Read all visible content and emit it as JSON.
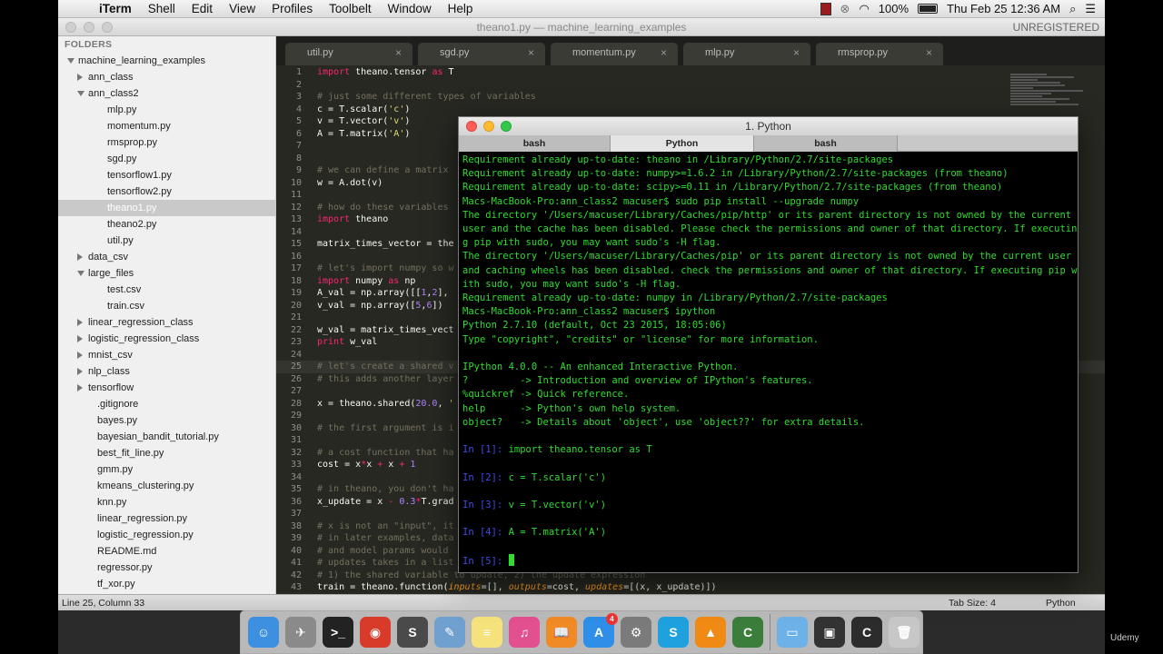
{
  "menubar": {
    "app": "iTerm",
    "items": [
      "Shell",
      "Edit",
      "View",
      "Profiles",
      "Toolbelt",
      "Window",
      "Help"
    ],
    "battery": "100%",
    "clock": "Thu Feb 25  12:36 AM"
  },
  "sublime": {
    "title": "theano1.py — machine_learning_examples",
    "registration": "UNREGISTERED"
  },
  "sidebar": {
    "header": "FOLDERS",
    "tree": [
      {
        "label": "machine_learning_examples",
        "depth": 0,
        "type": "folder-open"
      },
      {
        "label": "ann_class",
        "depth": 1,
        "type": "folder-closed"
      },
      {
        "label": "ann_class2",
        "depth": 1,
        "type": "folder-open"
      },
      {
        "label": "mlp.py",
        "depth": 2,
        "type": "file"
      },
      {
        "label": "momentum.py",
        "depth": 2,
        "type": "file"
      },
      {
        "label": "rmsprop.py",
        "depth": 2,
        "type": "file"
      },
      {
        "label": "sgd.py",
        "depth": 2,
        "type": "file"
      },
      {
        "label": "tensorflow1.py",
        "depth": 2,
        "type": "file"
      },
      {
        "label": "tensorflow2.py",
        "depth": 2,
        "type": "file"
      },
      {
        "label": "theano1.py",
        "depth": 2,
        "type": "file",
        "selected": true
      },
      {
        "label": "theano2.py",
        "depth": 2,
        "type": "file"
      },
      {
        "label": "util.py",
        "depth": 2,
        "type": "file"
      },
      {
        "label": "data_csv",
        "depth": 1,
        "type": "folder-closed"
      },
      {
        "label": "large_files",
        "depth": 1,
        "type": "folder-open"
      },
      {
        "label": "test.csv",
        "depth": 2,
        "type": "file"
      },
      {
        "label": "train.csv",
        "depth": 2,
        "type": "file"
      },
      {
        "label": "linear_regression_class",
        "depth": 1,
        "type": "folder-closed"
      },
      {
        "label": "logistic_regression_class",
        "depth": 1,
        "type": "folder-closed"
      },
      {
        "label": "mnist_csv",
        "depth": 1,
        "type": "folder-closed"
      },
      {
        "label": "nlp_class",
        "depth": 1,
        "type": "folder-closed"
      },
      {
        "label": "tensorflow",
        "depth": 1,
        "type": "folder-closed"
      },
      {
        "label": ".gitignore",
        "depth": 1,
        "type": "file"
      },
      {
        "label": "bayes.py",
        "depth": 1,
        "type": "file"
      },
      {
        "label": "bayesian_bandit_tutorial.py",
        "depth": 1,
        "type": "file"
      },
      {
        "label": "best_fit_line.py",
        "depth": 1,
        "type": "file"
      },
      {
        "label": "gmm.py",
        "depth": 1,
        "type": "file"
      },
      {
        "label": "kmeans_clustering.py",
        "depth": 1,
        "type": "file"
      },
      {
        "label": "knn.py",
        "depth": 1,
        "type": "file"
      },
      {
        "label": "linear_regression.py",
        "depth": 1,
        "type": "file"
      },
      {
        "label": "logistic_regression.py",
        "depth": 1,
        "type": "file"
      },
      {
        "label": "README.md",
        "depth": 1,
        "type": "file"
      },
      {
        "label": "regressor.py",
        "depth": 1,
        "type": "file"
      },
      {
        "label": "tf_xor.py",
        "depth": 1,
        "type": "file"
      }
    ]
  },
  "editor": {
    "tabs": [
      {
        "label": "util.py",
        "close": "×"
      },
      {
        "label": "sgd.py",
        "close": "×"
      },
      {
        "label": "momentum.py",
        "close": "×"
      },
      {
        "label": "mlp.py",
        "close": "×"
      },
      {
        "label": "rmsprop.py",
        "close": "×"
      }
    ],
    "highlighted_line": 25,
    "lines": [
      {
        "n": "1",
        "html": "<span class='k'>import</span> theano.tensor <span class='k'>as</span> T"
      },
      {
        "n": "2",
        "html": ""
      },
      {
        "n": "3",
        "html": "<span class='c'># just some different types of variables</span>"
      },
      {
        "n": "4",
        "html": "c = T.scalar(<span class='s'>'c'</span>)"
      },
      {
        "n": "5",
        "html": "v = T.vector(<span class='s'>'v'</span>)"
      },
      {
        "n": "6",
        "html": "A = T.matrix(<span class='s'>'A'</span>)"
      },
      {
        "n": "7",
        "html": ""
      },
      {
        "n": "8",
        "html": ""
      },
      {
        "n": "9",
        "html": "<span class='c'># we can define a matrix</span>"
      },
      {
        "n": "10",
        "html": "w = A.dot(v)"
      },
      {
        "n": "11",
        "html": ""
      },
      {
        "n": "12",
        "html": "<span class='c'># how do these variables</span>"
      },
      {
        "n": "13",
        "html": "<span class='k'>import</span> theano"
      },
      {
        "n": "14",
        "html": ""
      },
      {
        "n": "15",
        "html": "matrix_times_vector = the"
      },
      {
        "n": "16",
        "html": ""
      },
      {
        "n": "17",
        "html": "<span class='c'># let's import numpy so w</span>"
      },
      {
        "n": "18",
        "html": "<span class='k'>import</span> numpy <span class='k'>as</span> np"
      },
      {
        "n": "19",
        "html": "A_val = np.array([[<span class='n'>1</span>,<span class='n'>2</span>],"
      },
      {
        "n": "20",
        "html": "v_val = np.array([<span class='n'>5</span>,<span class='n'>6</span>])"
      },
      {
        "n": "21",
        "html": ""
      },
      {
        "n": "22",
        "html": "w_val = matrix_times_vect"
      },
      {
        "n": "23",
        "html": "<span class='k'>print</span> w_val"
      },
      {
        "n": "24",
        "html": ""
      },
      {
        "n": "25",
        "html": "<span class='c'># let's create a shared v</span>"
      },
      {
        "n": "26",
        "html": "<span class='c'># this adds another layer</span>"
      },
      {
        "n": "27",
        "html": ""
      },
      {
        "n": "28",
        "html": "x = theano.shared(<span class='n'>20.0</span>, <span class='s'>'</span>"
      },
      {
        "n": "29",
        "html": ""
      },
      {
        "n": "30",
        "html": "<span class='c'># the first argument is i</span>"
      },
      {
        "n": "31",
        "html": ""
      },
      {
        "n": "32",
        "html": "<span class='c'># a cost function that ha</span>"
      },
      {
        "n": "33",
        "html": "cost = x<span class='k'>*</span>x <span class='k'>+</span> x <span class='k'>+</span> <span class='n'>1</span>"
      },
      {
        "n": "34",
        "html": ""
      },
      {
        "n": "35",
        "html": "<span class='c'># in theano, you don't ha</span>"
      },
      {
        "n": "36",
        "html": "x_update = x <span class='k'>-</span> <span class='n'>0.3</span><span class='k'>*</span>T.grad"
      },
      {
        "n": "37",
        "html": ""
      },
      {
        "n": "38",
        "html": "<span class='c'># x is not an \"input\", it</span>"
      },
      {
        "n": "39",
        "html": "<span class='c'># in later examples, data</span>"
      },
      {
        "n": "40",
        "html": "<span class='c'># and model params would</span>"
      },
      {
        "n": "41",
        "html": "<span class='c'># updates takes in a list</span>"
      },
      {
        "n": "42",
        "html": "<span class='c'># 1) the shared variable to update, 2) the update expression</span>"
      },
      {
        "n": "43",
        "html": "train = theano.function(<span class='p'>inputs</span>=[], <span class='p'>outputs</span>=cost, <span class='p'>updates</span>=[(x, x_update)])"
      }
    ]
  },
  "statusbar": {
    "position": "Line 25, Column 33",
    "tab_size": "Tab Size: 4",
    "syntax": "Python"
  },
  "iterm": {
    "title": "1. Python",
    "tabs": [
      "bash",
      "Python",
      "bash"
    ],
    "active_tab": 1,
    "lines": [
      {
        "t": "Requirement already up-to-date: theano in /Library/Python/2.7/site-packages"
      },
      {
        "t": "Requirement already up-to-date: numpy>=1.6.2 in /Library/Python/2.7/site-packages (from theano)"
      },
      {
        "t": "Requirement already up-to-date: scipy>=0.11 in /Library/Python/2.7/site-packages (from theano)"
      },
      {
        "t": "Macs-MacBook-Pro:ann_class2 macuser$ sudo pip install --upgrade numpy"
      },
      {
        "t": "The directory '/Users/macuser/Library/Caches/pip/http' or its parent directory is not owned by the current"
      },
      {
        "t": "user and the cache has been disabled. Please check the permissions and owner of that directory. If executin"
      },
      {
        "t": "g pip with sudo, you may want sudo's -H flag."
      },
      {
        "t": "The directory '/Users/macuser/Library/Caches/pip' or its parent directory is not owned by the current user"
      },
      {
        "t": "and caching wheels has been disabled. check the permissions and owner of that directory. If executing pip w"
      },
      {
        "t": "ith sudo, you may want sudo's -H flag."
      },
      {
        "t": "Requirement already up-to-date: numpy in /Library/Python/2.7/site-packages"
      },
      {
        "t": "Macs-MacBook-Pro:ann_class2 macuser$ ipython"
      },
      {
        "t": "Python 2.7.10 (default, Oct 23 2015, 18:05:06)"
      },
      {
        "t": "Type \"copyright\", \"credits\" or \"license\" for more information."
      },
      {
        "t": ""
      },
      {
        "t": "IPython 4.0.0 -- An enhanced Interactive Python."
      },
      {
        "t": "?         -> Introduction and overview of IPython's features."
      },
      {
        "t": "%quickref -> Quick reference."
      },
      {
        "t": "help      -> Python's own help system."
      },
      {
        "t": "object?   -> Details about 'object', use 'object??' for extra details."
      },
      {
        "t": ""
      },
      {
        "p": "In [1]: ",
        "t": "import theano.tensor as T"
      },
      {
        "t": ""
      },
      {
        "p": "In [2]: ",
        "t": "c = T.scalar('c')"
      },
      {
        "t": ""
      },
      {
        "p": "In [3]: ",
        "t": "v = T.vector('v')"
      },
      {
        "t": ""
      },
      {
        "p": "In [4]: ",
        "t": "A = T.matrix('A')"
      },
      {
        "t": ""
      },
      {
        "p": "In [5]: ",
        "t": "",
        "cursor": true
      }
    ]
  },
  "watermark": "Udemy",
  "dock": [
    {
      "name": "finder-icon",
      "color": "#3d8fe0",
      "glyph": "☺"
    },
    {
      "name": "launchpad-icon",
      "color": "#8a8a8a",
      "glyph": "✈"
    },
    {
      "name": "terminal-icon",
      "color": "#222222",
      "glyph": ">_"
    },
    {
      "name": "chrome-icon",
      "color": "#d93b2b",
      "glyph": "◉"
    },
    {
      "name": "sublime-icon",
      "color": "#4a4a4a",
      "glyph": "S"
    },
    {
      "name": "preview-icon",
      "color": "#6fa0d0",
      "glyph": "✎"
    },
    {
      "name": "notes-icon",
      "color": "#f5e27a",
      "glyph": "≡"
    },
    {
      "name": "itunes-icon",
      "color": "#e2508f",
      "glyph": "♫"
    },
    {
      "name": "ibooks-icon",
      "color": "#f08a24",
      "glyph": "📖"
    },
    {
      "name": "appstore-icon",
      "color": "#2f8fe8",
      "glyph": "A",
      "badge": "4"
    },
    {
      "name": "system-preferences-icon",
      "color": "#7b7b7b",
      "glyph": "⚙"
    },
    {
      "name": "skype-icon",
      "color": "#1fa1e0",
      "glyph": "S"
    },
    {
      "name": "vlc-icon",
      "color": "#f08a14",
      "glyph": "▲"
    },
    {
      "name": "camtasia-icon",
      "color": "#3b7d3b",
      "glyph": "C"
    },
    {
      "name": "sep",
      "color": "",
      "glyph": ""
    },
    {
      "name": "folder-icon",
      "color": "#6cb2e8",
      "glyph": "▭"
    },
    {
      "name": "screen-recording-icon",
      "color": "#333333",
      "glyph": "▣"
    },
    {
      "name": "camtasia-recorder-icon",
      "color": "#2c2c2c",
      "glyph": "C"
    },
    {
      "name": "trash-icon",
      "color": "#c7c7c7",
      "glyph": "🗑"
    }
  ]
}
